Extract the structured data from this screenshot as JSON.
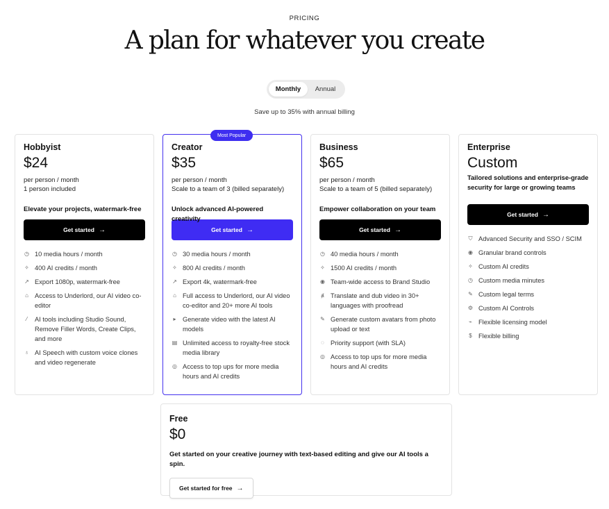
{
  "header": {
    "eyebrow": "PRICING",
    "title": "A plan for whatever you create"
  },
  "billing": {
    "monthly": "Monthly",
    "annual": "Annual",
    "selected": "Monthly",
    "savings": "Save up to 35% with annual billing"
  },
  "colors": {
    "accent": "#3f2cf3",
    "button_dark": "#000000"
  },
  "plans": [
    {
      "name": "Hobbyist",
      "price": "$24",
      "per": "per person / month",
      "seats": "1 person included",
      "tagline": "Elevate your projects, watermark-free",
      "cta": "Get started",
      "features": [
        {
          "icon": "clock-icon",
          "text": "10 media hours / month"
        },
        {
          "icon": "sparkle-icon",
          "text": "400 AI credits / month"
        },
        {
          "icon": "export-icon",
          "text": "Export 1080p, watermark-free"
        },
        {
          "icon": "robot-icon",
          "text": "Access to Underlord, our AI video co-editor"
        },
        {
          "icon": "wand-icon",
          "text": "AI tools including Studio Sound, Remove Filler Words, Create Clips, and more"
        },
        {
          "icon": "voice-icon",
          "text": "AI Speech with custom voice clones and video regenerate"
        }
      ]
    },
    {
      "name": "Creator",
      "badge": "Most Popular",
      "price": "$35",
      "per": "per person / month",
      "seats": "Scale to a team of 3 (billed separately)",
      "tagline": "Unlock advanced AI-powered creativity",
      "cta": "Get started",
      "features": [
        {
          "icon": "clock-icon",
          "text": "30 media hours / month"
        },
        {
          "icon": "sparkle-icon",
          "text": "800 AI credits / month"
        },
        {
          "icon": "export-icon",
          "text": "Export 4k, watermark-free"
        },
        {
          "icon": "robot-icon",
          "text": "Full access to Underlord, our AI video co-editor and 20+ more AI tools"
        },
        {
          "icon": "video-icon",
          "text": "Generate video with the latest AI models"
        },
        {
          "icon": "library-icon",
          "text": "Unlimited access to royalty-free stock media library"
        },
        {
          "icon": "coins-icon",
          "text": "Access to top ups for more media hours and AI credits"
        }
      ]
    },
    {
      "name": "Business",
      "price": "$65",
      "per": "per person / month",
      "seats": "Scale to a team of 5 (billed separately)",
      "tagline": "Empower collaboration on your team",
      "cta": "Get started",
      "features": [
        {
          "icon": "clock-icon",
          "text": "40 media hours / month"
        },
        {
          "icon": "sparkle-icon",
          "text": "1500 AI credits / month"
        },
        {
          "icon": "brand-icon",
          "text": "Team-wide access to Brand Studio"
        },
        {
          "icon": "translate-icon",
          "text": "Translate and dub video in 30+ languages with proofread"
        },
        {
          "icon": "avatar-icon",
          "text": "Generate custom avatars from photo upload or text"
        },
        {
          "icon": "support-icon",
          "text": "Priority support (with SLA)"
        },
        {
          "icon": "coins-icon",
          "text": "Access to top ups for more media hours and AI credits"
        }
      ]
    },
    {
      "name": "Enterprise",
      "price": "Custom",
      "description": "Tailored solutions and enterprise-grade security for large or growing teams",
      "cta": "Get started",
      "features": [
        {
          "icon": "shield-icon",
          "text": "Advanced Security and SSO / SCIM"
        },
        {
          "icon": "brand-icon",
          "text": "Granular brand controls"
        },
        {
          "icon": "sparkle-icon",
          "text": "Custom AI credits"
        },
        {
          "icon": "clock-icon",
          "text": "Custom media minutes"
        },
        {
          "icon": "pen-icon",
          "text": "Custom legal terms"
        },
        {
          "icon": "gear-icon",
          "text": "Custom AI Controls"
        },
        {
          "icon": "license-icon",
          "text": "Flexible licensing model"
        },
        {
          "icon": "dollar-icon",
          "text": "Flexible billing"
        }
      ]
    }
  ],
  "free": {
    "name": "Free",
    "price": "$0",
    "description": "Get started on your creative journey with text-based editing and give our AI tools a spin.",
    "cta": "Get started for free"
  }
}
